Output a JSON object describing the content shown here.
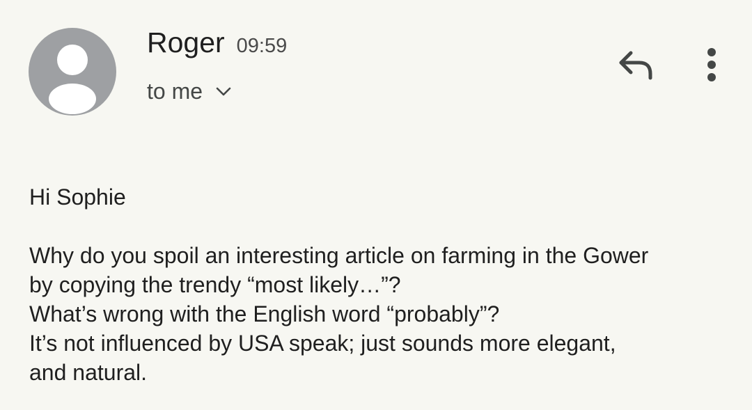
{
  "header": {
    "sender": "Roger",
    "time": "09:59",
    "recipient": "to me",
    "avatar_icon": "person-icon",
    "avatar_color": "#9ea0a3",
    "reply_icon": "reply-icon",
    "more_icon": "more-vert-icon",
    "expand_icon": "chevron-down-icon"
  },
  "message": {
    "greeting": "Hi Sophie",
    "lines": [
      "Why do you spoil an interesting article on farming in the Gower",
      "by copying the trendy “most likely…”?",
      "What’s wrong with the English word “probably”?",
      "It’s not influenced by USA speak; just sounds more elegant,",
      "and natural."
    ]
  }
}
